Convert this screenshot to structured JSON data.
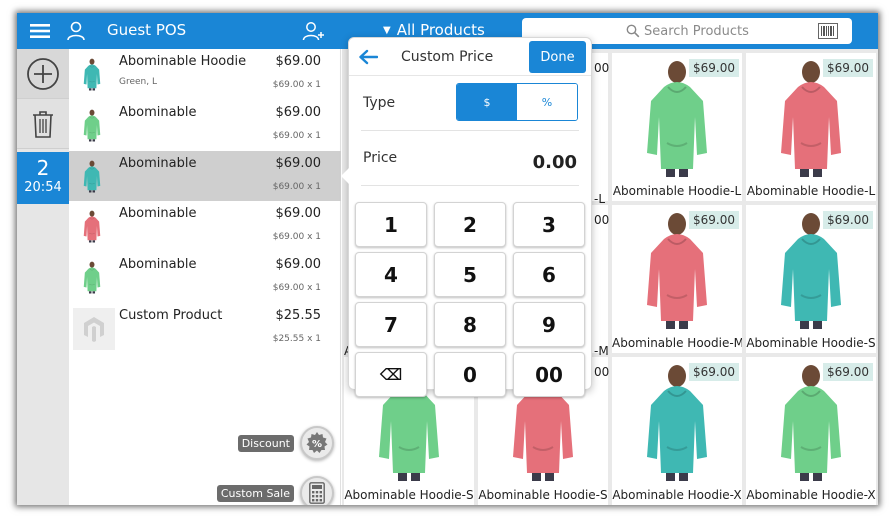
{
  "topbar": {
    "guest_label": "Guest POS",
    "category_label": "All Products",
    "search_placeholder": "Search Products"
  },
  "order_tab": {
    "number": "2",
    "time": "20:54"
  },
  "cart": {
    "items": [
      {
        "name": "Abominable Hoodie",
        "options": "Green, L",
        "price": "$69.00",
        "qty": "$69.00 x 1",
        "color": "#3fb8b3"
      },
      {
        "name": "Abominable",
        "options": "",
        "price": "$69.00",
        "qty": "$69.00 x 1",
        "color": "#6fcf8a"
      },
      {
        "name": "Abominable",
        "options": "",
        "price": "$69.00",
        "qty": "$69.00 x 1",
        "color": "#3fb8b3"
      },
      {
        "name": "Abominable",
        "options": "",
        "price": "$69.00",
        "qty": "$69.00 x 1",
        "color": "#e5707a"
      },
      {
        "name": "Abominable",
        "options": "",
        "price": "$69.00",
        "qty": "$69.00 x 1",
        "color": "#6fcf8a"
      },
      {
        "name": "Custom Product",
        "options": "",
        "price": "$25.55",
        "qty": "$25.55 x 1",
        "color": ""
      }
    ],
    "discount_label": "Discount",
    "custom_sale_label": "Custom Sale"
  },
  "products": [
    {
      "name": "",
      "price": "",
      "color": "#e5707a"
    },
    {
      "name": "Abominable Hoodie-L",
      "price": "$69.00",
      "color": "#6fcf8a"
    },
    {
      "name": "Abominable Hoodie-L",
      "price": "$69.00",
      "color": "#e5707a"
    },
    {
      "name": "",
      "price": "",
      "color": "#6fcf8a"
    },
    {
      "name": "Abominable Hoodie-M",
      "price": "$69.00",
      "color": "#e5707a"
    },
    {
      "name": "Abominable Hoodie-S",
      "price": "$69.00",
      "color": "#3fb8b3"
    },
    {
      "name": "Abominable Hoodie-S",
      "price": "",
      "color": "#6fcf8a"
    },
    {
      "name": "Abominable Hoodie-S",
      "price": "",
      "color": "#e5707a"
    },
    {
      "name": "Abominable Hoodie-X",
      "price": "$69.00",
      "color": "#3fb8b3"
    },
    {
      "name": "Abominable Hoodie-X",
      "price": "$69.00",
      "color": "#6fcf8a"
    }
  ],
  "partial_labels": {
    "row1": "-L",
    "row2": "-M",
    "row2_left": "A",
    "row1_price_frag": "00",
    "row2_price_frag": "00",
    "row3_price_frag": "00"
  },
  "popup": {
    "title": "Custom Price",
    "done_label": "Done",
    "type_label": "Type",
    "type_options": [
      "$",
      "%"
    ],
    "price_label": "Price",
    "price_value": "0.00",
    "keys": [
      "1",
      "2",
      "3",
      "4",
      "5",
      "6",
      "7",
      "8",
      "9",
      "⌫",
      "0",
      "00"
    ]
  },
  "colors": {
    "accent": "#1a86d6"
  }
}
